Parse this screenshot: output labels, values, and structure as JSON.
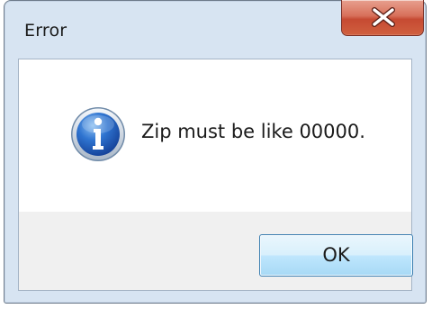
{
  "dialog": {
    "title": "Error",
    "message": "Zip must be like 00000.",
    "icon": "info-icon",
    "ok_label": "OK"
  },
  "colors": {
    "close_button": "#c9533b",
    "ok_button_border": "#3c7fb1",
    "frame": "#d7e4f2",
    "button_panel": "#f0f0f0"
  }
}
